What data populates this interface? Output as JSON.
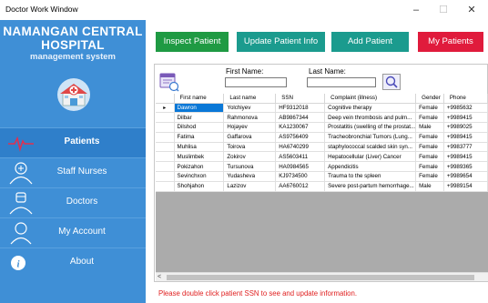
{
  "window": {
    "title": "Doctor Work Window",
    "minimize_glyph": "–",
    "maximize_glyph": "☐",
    "close_glyph": "✕"
  },
  "brand": {
    "line1": "NAMANGAN CENTRAL",
    "line2": "HOSPITAL",
    "line3": "management system",
    "logo_icon": "hospital-icon"
  },
  "sidebar": {
    "items": [
      {
        "label": "Patients",
        "icon": "heartbeat-icon",
        "active": true
      },
      {
        "label": "Staff Nurses",
        "icon": "nurse-icon",
        "active": false
      },
      {
        "label": "Doctors",
        "icon": "doctor-icon",
        "active": false
      },
      {
        "label": "My Account",
        "icon": "user-icon",
        "active": false
      },
      {
        "label": "About",
        "icon": "info-icon",
        "active": false
      }
    ]
  },
  "toolbar": {
    "inspect": "Inspect Patient",
    "update": "Update Patient Info",
    "add": "Add Patient",
    "my_patients": "My Patients"
  },
  "search": {
    "first_name_label": "First Name:",
    "last_name_label": "Last Name:",
    "first_name_value": "",
    "last_name_value": ""
  },
  "grid": {
    "columns": [
      "First name",
      "Last name",
      "SSN",
      "Complaint (illness)",
      "Gender",
      "Phone"
    ],
    "rows": [
      [
        "Dawron",
        "Yolchiyev",
        "HF9312018",
        "Cognitive therapy",
        "Female",
        "+9985632"
      ],
      [
        "Dilbar",
        "Rahmonova",
        "AB9867344",
        "Deep vein thrombosis and pulm...",
        "Female",
        "+9989415"
      ],
      [
        "Dilshod",
        "Hojayev",
        "KA1230067",
        "Prostatitis (swelling of the prostat...",
        "Male",
        "+9989025"
      ],
      [
        "Fatima",
        "Gaffarova",
        "AS9756409",
        "Tracheobronchial Tumors (Lung...",
        "Female",
        "+9989415"
      ],
      [
        "Muhlisa",
        "Toirova",
        "HA6740299",
        "staphylococcal scalded skin syn...",
        "Female",
        "+9983777"
      ],
      [
        "Muslimbek",
        "Zokirov",
        "AS5603411",
        "Hepatocellular (Liver) Cancer",
        "Female",
        "+9989415"
      ],
      [
        "Pokizahon",
        "Tursunova",
        "HA0984565",
        "Appendicitis",
        "Female",
        "+9989365"
      ],
      [
        "Sevinchxon",
        "Yudasheva",
        "KJ9734500",
        "Trauma to the spleen",
        "Female",
        "+9989654"
      ],
      [
        "Shohjahon",
        "Lazizov",
        "AA6760012",
        "Severe post-partum hemorrhage...",
        "Male",
        "+9989154"
      ]
    ],
    "selected_row_marker": "▸",
    "scroll_left_glyph": "<"
  },
  "hint": "Please double click patient SSN to see and update information.",
  "colors": {
    "sidebar": "#3f8fd6",
    "inspect": "#1f9a43",
    "update": "#1b9b8e",
    "add": "#1b9b8e",
    "my_patients": "#e01b3c",
    "hint": "#e02020"
  }
}
